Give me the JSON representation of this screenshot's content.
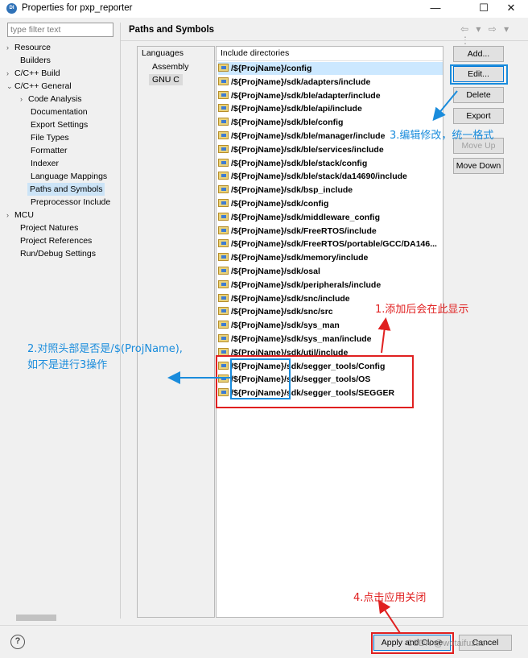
{
  "window": {
    "title": "Properties for pxp_reporter",
    "icon_label": "DI",
    "controls": {
      "minimize": "—",
      "maximize": "☐",
      "close": "✕"
    }
  },
  "sidebar": {
    "filter_placeholder": "type filter text",
    "items": [
      {
        "label": "Resource",
        "chevron": "›"
      },
      {
        "label": "Builders",
        "chevron": ""
      },
      {
        "label": "C/C++ Build",
        "chevron": "›"
      },
      {
        "label": "C/C++ General",
        "chevron": "⌄"
      },
      {
        "label": "Code Analysis",
        "chevron": "›"
      },
      {
        "label": "Documentation",
        "chevron": ""
      },
      {
        "label": "Export Settings",
        "chevron": ""
      },
      {
        "label": "File Types",
        "chevron": ""
      },
      {
        "label": "Formatter",
        "chevron": ""
      },
      {
        "label": "Indexer",
        "chevron": ""
      },
      {
        "label": "Language Mappings",
        "chevron": ""
      },
      {
        "label": "Paths and Symbols",
        "chevron": ""
      },
      {
        "label": "Preprocessor Include",
        "chevron": ""
      },
      {
        "label": "MCU",
        "chevron": "›"
      },
      {
        "label": "Project Natures",
        "chevron": ""
      },
      {
        "label": "Project References",
        "chevron": ""
      },
      {
        "label": "Run/Debug Settings",
        "chevron": ""
      }
    ]
  },
  "main": {
    "title": "Paths and Symbols",
    "nav_arrows": "⇦ ▾ ⇨ ▾ ⋮",
    "languages_header": "Languages",
    "languages": [
      "Assembly",
      "GNU C"
    ],
    "includes_header": "Include directories",
    "includes": [
      "/${ProjName}/config",
      "/${ProjName}/sdk/adapters/include",
      "/${ProjName}/sdk/ble/adapter/include",
      "/${ProjName}/sdk/ble/api/include",
      "/${ProjName}/sdk/ble/config",
      "/${ProjName}/sdk/ble/manager/include",
      "/${ProjName}/sdk/ble/services/include",
      "/${ProjName}/sdk/ble/stack/config",
      "/${ProjName}/sdk/ble/stack/da14690/include",
      "/${ProjName}/sdk/bsp_include",
      "/${ProjName}/sdk/config",
      "/${ProjName}/sdk/middleware_config",
      "/${ProjName}/sdk/FreeRTOS/include",
      "/${ProjName}/sdk/FreeRTOS/portable/GCC/DA146...",
      "/${ProjName}/sdk/memory/include",
      "/${ProjName}/sdk/osal",
      "/${ProjName}/sdk/peripherals/include",
      "/${ProjName}/sdk/snc/include",
      "/${ProjName}/sdk/snc/src",
      "/${ProjName}/sdk/sys_man",
      "/${ProjName}/sdk/sys_man/include",
      "/${ProjName}/sdk/util/include",
      "/${ProjName}/sdk/segger_tools/Config",
      "/${ProjName}/sdk/segger_tools/OS",
      "/${ProjName}/sdk/segger_tools/SEGGER"
    ],
    "buttons": {
      "add": "Add...",
      "edit": "Edit...",
      "delete": "Delete",
      "export": "Export",
      "move_up": "Move Up",
      "move_down": "Move Down"
    }
  },
  "footer": {
    "help": "?",
    "apply_close": "Apply and Close",
    "cancel": "Cancel"
  },
  "annotations": {
    "step1": "1.添加后会在此显示",
    "step2_line1": "2.对照头部是否是/$(ProjName),",
    "step2_line2": "如不是进行3操作",
    "step3": "3.编辑修改，统一格式",
    "step4": "4.点击应用关闭",
    "watermark": "CSDN @wotaifuzao"
  },
  "colors": {
    "annotation_red": "#e02020",
    "annotation_blue": "#1a8cdc",
    "selection": "#cce8ff"
  }
}
